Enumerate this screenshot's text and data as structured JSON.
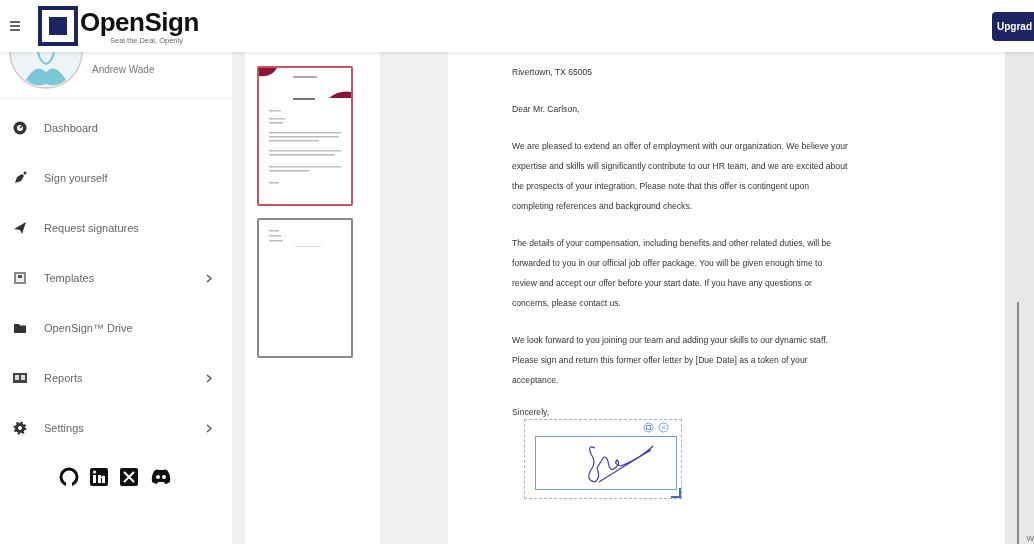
{
  "header": {
    "logo": "OpenSign",
    "tagline": "Seal the Deal, Openly",
    "upgrade_button": "Upgrad"
  },
  "user": {
    "name": "Andrew Wade"
  },
  "sidebar": {
    "items": [
      {
        "label": "Dashboard",
        "kind": "gauge",
        "submenu": false
      },
      {
        "label": "Sign yourself",
        "kind": "pen",
        "submenu": false
      },
      {
        "label": "Request signatures",
        "kind": "plane",
        "submenu": false
      },
      {
        "label": "Templates",
        "kind": "template",
        "submenu": true
      },
      {
        "label": "OpenSign™ Drive",
        "kind": "folder",
        "submenu": false
      },
      {
        "label": "Reports",
        "kind": "card",
        "submenu": true
      },
      {
        "label": "Settings",
        "kind": "gear",
        "submenu": true
      }
    ]
  },
  "thumbnails": [
    {
      "selected": true,
      "kind": "letterhead"
    },
    {
      "selected": false,
      "kind": "plain"
    }
  ],
  "document": {
    "paragraphs": [
      [
        "Rivertown, TX 65005"
      ],
      [
        "Dear Mr. Carlson,"
      ],
      [
        "We are pleased to extend an offer of employment with our organization. We believe your",
        "expertise and skills will significantly contribute to our HR team, and we are excited about",
        "the prospects of your integration. Please note that this offer is contingent upon",
        "completing references and background checks."
      ],
      [
        "The details of your compensation, including benefits and other related duties, will be",
        "forwarded to you in our official job offer package. You will be given enough time to",
        "review and accept our offer before your start date. If you have any questions or",
        "concerns, please contact us."
      ],
      [
        "We look forward to you joining our team and adding your skills to our dynamic staff.",
        "Please sign and return this former offer letter by [Due Date] as a token of your",
        "acceptance."
      ]
    ],
    "closing": "Sincerely,"
  },
  "edge_text": "W"
}
